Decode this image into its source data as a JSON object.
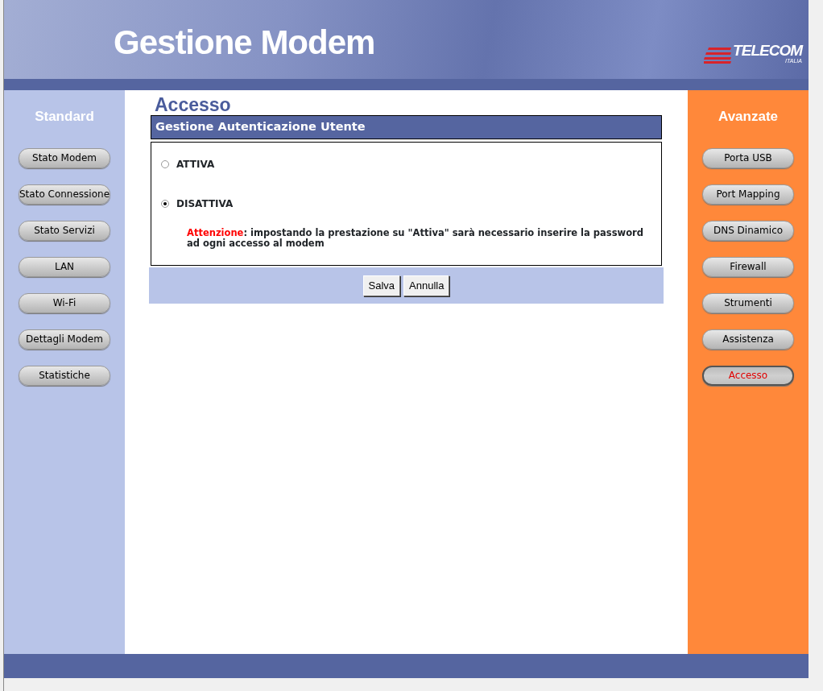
{
  "header": {
    "title": "Gestione Modem",
    "logo": {
      "name": "TELECOM",
      "sub": "ITALIA"
    }
  },
  "sidebar_left": {
    "title": "Standard",
    "items": [
      {
        "label": "Stato Modem",
        "selected": false
      },
      {
        "label": "Stato Connessione",
        "selected": false
      },
      {
        "label": "Stato Servizi",
        "selected": false
      },
      {
        "label": "LAN",
        "selected": false
      },
      {
        "label": "Wi-Fi",
        "selected": false
      },
      {
        "label": "Dettagli Modem",
        "selected": false
      },
      {
        "label": "Statistiche",
        "selected": false
      }
    ]
  },
  "content": {
    "title": "Accesso",
    "section": "Gestione Autenticazione Utente",
    "options": [
      {
        "label": "ATTIVA",
        "selected": false
      },
      {
        "label": "DISATTIVA",
        "selected": true
      }
    ],
    "note": {
      "label": "Attenzione",
      "text": ": impostando la prestazione su \"Attiva\" sarà necessario inserire la password ad ogni accesso al modem"
    },
    "buttons": [
      "Salva",
      "Annulla"
    ]
  },
  "sidebar_right": {
    "title": "Avanzate",
    "items": [
      {
        "label": "Porta USB",
        "selected": false
      },
      {
        "label": "Port Mapping",
        "selected": false
      },
      {
        "label": "DNS Dinamico",
        "selected": false
      },
      {
        "label": "Firewall",
        "selected": false
      },
      {
        "label": "Strumenti",
        "selected": false
      },
      {
        "label": "Assistenza",
        "selected": false
      },
      {
        "label": "Accesso",
        "selected": true
      }
    ]
  }
}
